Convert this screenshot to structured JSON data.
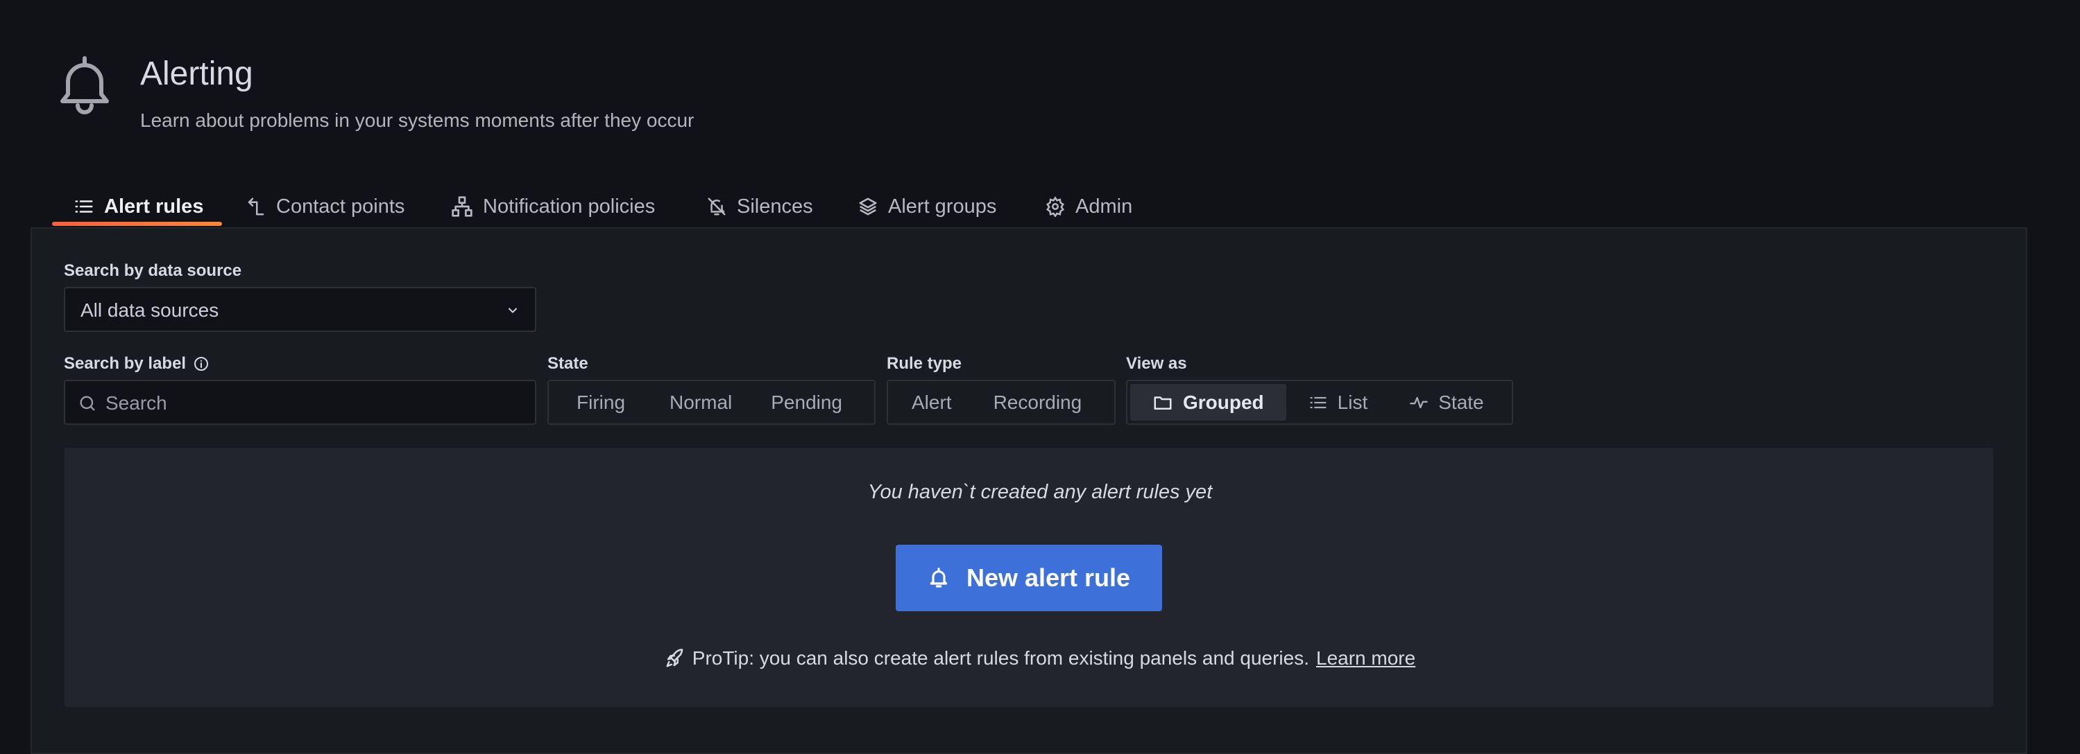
{
  "header": {
    "title": "Alerting",
    "subtitle": "Learn about problems in your systems moments after they occur"
  },
  "tabs": [
    {
      "label": "Alert rules",
      "icon": "list-icon",
      "active": true
    },
    {
      "label": "Contact points",
      "icon": "contact-points-icon"
    },
    {
      "label": "Notification policies",
      "icon": "sitemap-icon"
    },
    {
      "label": "Silences",
      "icon": "bell-slash-icon"
    },
    {
      "label": "Alert groups",
      "icon": "layers-icon"
    },
    {
      "label": "Admin",
      "icon": "gear-icon"
    }
  ],
  "filters": {
    "datasource_label": "Search by data source",
    "datasource_value": "All data sources",
    "label_search_label": "Search by label",
    "search_placeholder": "Search",
    "state_label": "State",
    "state_options": [
      "Firing",
      "Normal",
      "Pending"
    ],
    "ruletype_label": "Rule type",
    "ruletype_options": [
      "Alert",
      "Recording"
    ],
    "viewas_label": "View as",
    "viewas_options": [
      "Grouped",
      "List",
      "State"
    ],
    "viewas_selected": "Grouped"
  },
  "empty_state": {
    "message": "You haven`t created any alert rules yet",
    "button_label": "New alert rule",
    "protip": "ProTip: you can also create alert rules from existing panels and queries.",
    "learn_more": "Learn more"
  },
  "colors": {
    "background": "#111217",
    "panel": "#181b1f",
    "primary_button": "#3d71d9",
    "tab_underline": "#ff7a3d"
  }
}
